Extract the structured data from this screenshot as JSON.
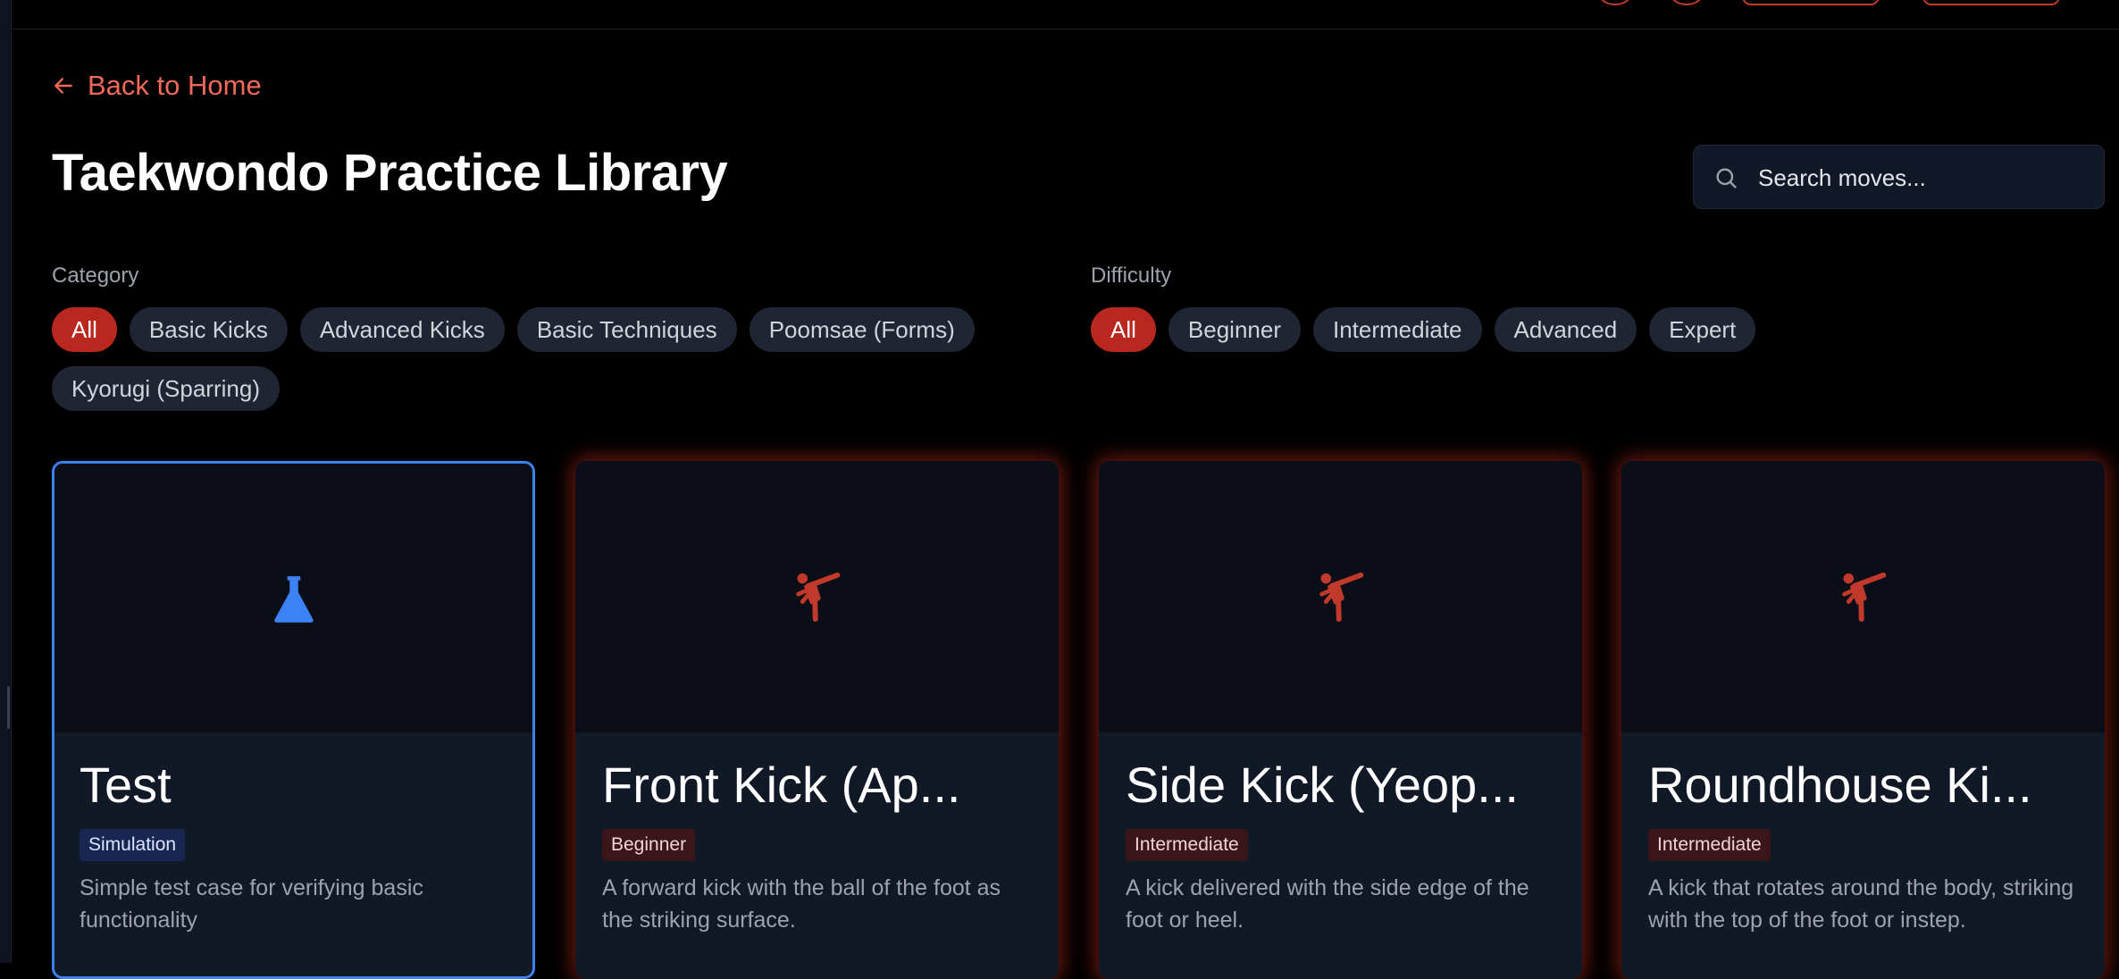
{
  "nav": {
    "back_label": "Back to Home"
  },
  "page": {
    "title": "Taekwondo Practice Library"
  },
  "search": {
    "placeholder": "Search moves..."
  },
  "filters": {
    "category": {
      "label": "Category",
      "options": [
        "All",
        "Basic Kicks",
        "Advanced Kicks",
        "Basic Techniques",
        "Poomsae (Forms)",
        "Kyorugi (Sparring)"
      ],
      "selected": "All"
    },
    "difficulty": {
      "label": "Difficulty",
      "options": [
        "All",
        "Beginner",
        "Intermediate",
        "Advanced",
        "Expert"
      ],
      "selected": "All"
    }
  },
  "cards": [
    {
      "title": "Test",
      "badge": "Simulation",
      "description": "Simple test case for verifying basic functionality",
      "icon": "flask-icon",
      "icon_color": "#3b82f6"
    },
    {
      "title": "Front Kick (Ap...",
      "badge": "Beginner",
      "description": "A forward kick with the ball of the foot as the striking surface.",
      "icon": "martial-arts-kick-icon",
      "icon_color": "#c0392b"
    },
    {
      "title": "Side Kick (Yeop...",
      "badge": "Intermediate",
      "description": "A kick delivered with the side edge of the foot or heel.",
      "icon": "martial-arts-kick-icon",
      "icon_color": "#c0392b"
    },
    {
      "title": "Roundhouse Ki...",
      "badge": "Intermediate",
      "description": "A kick that rotates around the body, striking with the top of the foot or instep.",
      "icon": "martial-arts-kick-icon",
      "icon_color": "#c0392b"
    }
  ],
  "colors": {
    "accent": "#ef6a5a",
    "active_chip": "#b9271e",
    "simulation_border": "#3b82f6",
    "background": "#000000"
  }
}
